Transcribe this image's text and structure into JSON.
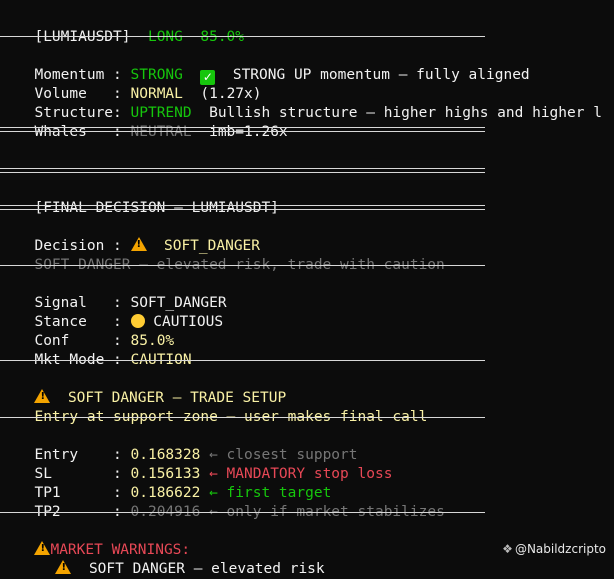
{
  "header": {
    "symbol": "[LUMIAUSDT]",
    "direction": "LONG",
    "confidence": "85.0%"
  },
  "metrics": [
    {
      "label": "Momentum :",
      "value": "STRONG",
      "color": "#16c60c",
      "icon": "check-icon",
      "desc": "STRONG UP momentum — fully aligned"
    },
    {
      "label": "Volume   :",
      "value": "NORMAL",
      "color": "#f9f1a5",
      "desc": "(1.27x)"
    },
    {
      "label": "Structure:",
      "value": "UPTREND",
      "color": "#16c60c",
      "desc": "Bullish structure — higher highs and higher l"
    },
    {
      "label": "Whales   :",
      "value": "NEUTRAL",
      "color": "#767676",
      "desc": "imb=1.26x"
    }
  ],
  "final": {
    "title": "[FINAL DECISION — LUMIAUSDT]"
  },
  "decision": {
    "label": "Decision :",
    "value": "SOFT_DANGER",
    "note": "SOFT DANGER — elevated risk, trade with caution"
  },
  "signal": {
    "signal_label": "Signal   :",
    "signal_value": "SOFT_DANGER",
    "stance_label": "Stance   :",
    "stance_value": "CAUTIOUS",
    "conf_label": "Conf     :",
    "conf_value": "85.0%",
    "mode_label": "Mkt Mode :",
    "mode_value": "CAUTION"
  },
  "setup": {
    "title": "SOFT DANGER — TRADE SETUP",
    "subtitle": "Entry at support zone — user makes final call"
  },
  "levels": [
    {
      "label": "Entry    :",
      "value": "0.168328",
      "note": "← closest support",
      "value_color": "#f9f1a5",
      "note_color": "#767676"
    },
    {
      "label": "SL       :",
      "value": "0.156133",
      "note": "← MANDATORY stop loss",
      "value_color": "#f9f1a5",
      "note_color": "#e74856"
    },
    {
      "label": "TP1      :",
      "value": "0.186622",
      "note": "← first target",
      "value_color": "#f9f1a5",
      "note_color": "#16c60c"
    },
    {
      "label": "TP2      :",
      "value": "0.204916",
      "note": "← only if market stabilizes",
      "value_color": "#767676",
      "note_color": "#767676"
    }
  ],
  "warnings": {
    "title": "MARKET WARNINGS:",
    "item": "SOFT DANGER — elevated risk"
  },
  "watermark": {
    "handle": "@Nabildzcripto"
  }
}
